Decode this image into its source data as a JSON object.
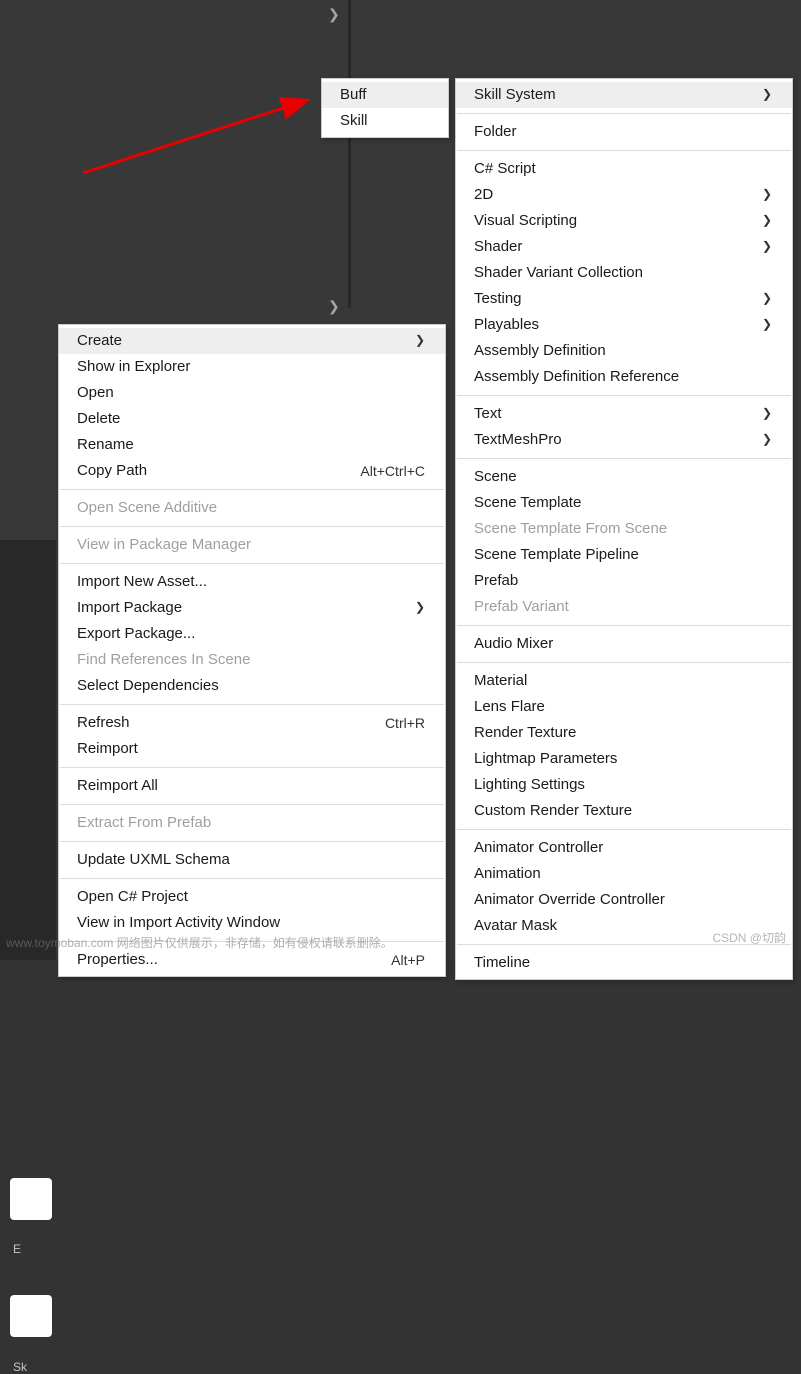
{
  "expand_arrow_glyph": "❯",
  "labels": {
    "card1": "E",
    "card2": "Sk"
  },
  "main_menu": [
    {
      "label": "Create",
      "submenu": true,
      "highlight": true
    },
    {
      "label": "Show in Explorer"
    },
    {
      "label": "Open"
    },
    {
      "label": "Delete"
    },
    {
      "label": "Rename"
    },
    {
      "label": "Copy Path",
      "shortcut": "Alt+Ctrl+C"
    },
    {
      "sep": true
    },
    {
      "label": "Open Scene Additive",
      "disabled": true
    },
    {
      "sep": true
    },
    {
      "label": "View in Package Manager",
      "disabled": true
    },
    {
      "sep": true
    },
    {
      "label": "Import New Asset..."
    },
    {
      "label": "Import Package",
      "submenu": true
    },
    {
      "label": "Export Package..."
    },
    {
      "label": "Find References In Scene",
      "disabled": true
    },
    {
      "label": "Select Dependencies"
    },
    {
      "sep": true
    },
    {
      "label": "Refresh",
      "shortcut": "Ctrl+R"
    },
    {
      "label": "Reimport"
    },
    {
      "sep": true
    },
    {
      "label": "Reimport All"
    },
    {
      "sep": true
    },
    {
      "label": "Extract From Prefab",
      "disabled": true
    },
    {
      "sep": true
    },
    {
      "label": "Update UXML Schema"
    },
    {
      "sep": true
    },
    {
      "label": "Open C# Project"
    },
    {
      "label": "View in Import Activity Window"
    },
    {
      "sep": true
    },
    {
      "label": "Properties...",
      "shortcut": "Alt+P"
    }
  ],
  "sub_top_menu": [
    {
      "label": "Buff",
      "highlight": true
    },
    {
      "label": "Skill"
    }
  ],
  "create_menu": [
    {
      "label": "Skill System",
      "submenu": true,
      "highlight": true
    },
    {
      "sep": true
    },
    {
      "label": "Folder"
    },
    {
      "sep": true
    },
    {
      "label": "C# Script"
    },
    {
      "label": "2D",
      "submenu": true
    },
    {
      "label": "Visual Scripting",
      "submenu": true
    },
    {
      "label": "Shader",
      "submenu": true
    },
    {
      "label": "Shader Variant Collection"
    },
    {
      "label": "Testing",
      "submenu": true
    },
    {
      "label": "Playables",
      "submenu": true
    },
    {
      "label": "Assembly Definition"
    },
    {
      "label": "Assembly Definition Reference"
    },
    {
      "sep": true
    },
    {
      "label": "Text",
      "submenu": true
    },
    {
      "label": "TextMeshPro",
      "submenu": true
    },
    {
      "sep": true
    },
    {
      "label": "Scene"
    },
    {
      "label": "Scene Template"
    },
    {
      "label": "Scene Template From Scene",
      "disabled": true
    },
    {
      "label": "Scene Template Pipeline"
    },
    {
      "label": "Prefab"
    },
    {
      "label": "Prefab Variant",
      "disabled": true
    },
    {
      "sep": true
    },
    {
      "label": "Audio Mixer"
    },
    {
      "sep": true
    },
    {
      "label": "Material"
    },
    {
      "label": "Lens Flare"
    },
    {
      "label": "Render Texture"
    },
    {
      "label": "Lightmap Parameters"
    },
    {
      "label": "Lighting Settings"
    },
    {
      "label": "Custom Render Texture"
    },
    {
      "sep": true
    },
    {
      "label": "Animator Controller"
    },
    {
      "label": "Animation"
    },
    {
      "label": "Animator Override Controller"
    },
    {
      "label": "Avatar Mask"
    },
    {
      "sep": true
    },
    {
      "label": "Timeline"
    }
  ],
  "watermarks": {
    "left": "www.toymoban.com 网络图片仅供展示，非存储，如有侵权请联系删除。",
    "right": "CSDN @切韵"
  },
  "arrow_color": "#e60000"
}
